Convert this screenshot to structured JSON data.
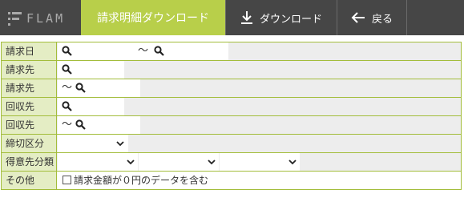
{
  "header": {
    "logo_text": "FLAM",
    "active_tab": "請求明細ダウンロード",
    "download_label": "ダウンロード",
    "back_label": "戻る"
  },
  "form": {
    "tilde": "～",
    "rows": [
      {
        "label": "請求日"
      },
      {
        "label": "請求先"
      },
      {
        "label": "請求先"
      },
      {
        "label": "回収先"
      },
      {
        "label": "回収先"
      },
      {
        "label": "締切区分"
      },
      {
        "label": "得意先分類"
      },
      {
        "label": "その他",
        "checkbox_label": "請求金額が０円のデータを含む",
        "checked": false
      }
    ]
  },
  "colors": {
    "header_bg": "#464646",
    "accent": "#b8cf4a",
    "border": "#a3bd3b",
    "label_bg": "#e4edc4"
  }
}
